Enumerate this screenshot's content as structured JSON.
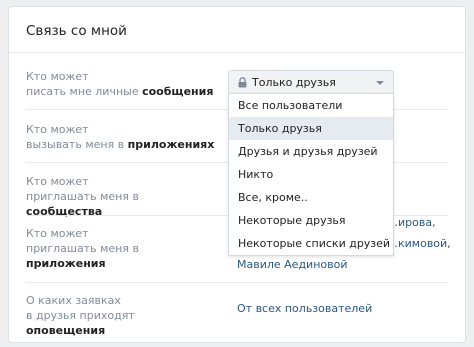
{
  "section": {
    "title": "Связь со мной"
  },
  "rows": [
    {
      "line1": "Кто может",
      "line2_pre": "писать мне личные ",
      "line2_bold": "сообщения"
    },
    {
      "line1": "Кто может",
      "line2_pre": "вызывать меня в ",
      "line2_bold": "приложениях"
    },
    {
      "line1": "Кто может",
      "line2_pre": "приглашать меня в ",
      "line2_bold": "сообщества"
    },
    {
      "line1": "Кто может",
      "line2_pre": "приглашать меня в ",
      "line2_bold": "приложения",
      "value_lines": [
        "…ирова,",
        "…кимовой,",
        "Мавиле Аединовой"
      ]
    },
    {
      "line1": "О каких заявках",
      "line2_pre": "в друзья приходят ",
      "line2_bold": "оповещения",
      "value": "От всех пользователей"
    }
  ],
  "privacy_select": {
    "selected": "Только друзья",
    "icon": "lock-icon",
    "options": [
      "Все пользователи",
      "Только друзья",
      "Друзья и друзья друзей",
      "Никто",
      "Все, кроме..",
      "Некоторые друзья",
      "Некоторые списки друзей"
    ],
    "hovered_index": 1
  },
  "colors": {
    "link": "#2a5885",
    "label": "#818c99",
    "hover": "#e5ebf1",
    "page_bg": "#edeef0"
  }
}
